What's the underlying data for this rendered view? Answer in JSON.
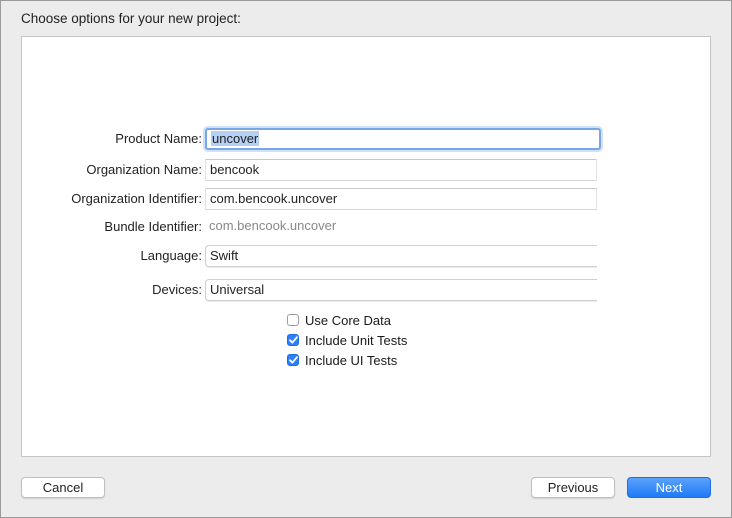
{
  "dialog": {
    "title": "Choose options for your new project:"
  },
  "form": {
    "product_name": {
      "label": "Product Name:",
      "value": "uncover"
    },
    "team": {
      "label": "Organization Name:",
      "value": "bencook"
    },
    "organization_identifier": {
      "label": "Organization Identifier:",
      "value": "com.bencook.uncover"
    },
    "bundle_identifier": {
      "label": "Bundle Identifier:",
      "value": "com.bencook.uncover"
    },
    "language": {
      "label": "Language:",
      "value": "Swift"
    },
    "devices": {
      "label": "Devices:",
      "value": "Universal"
    }
  },
  "options": [
    {
      "label": "Use Core Data",
      "checked": false
    },
    {
      "label": "Include Unit Tests",
      "checked": true
    },
    {
      "label": "Include UI Tests",
      "checked": true
    }
  ],
  "buttons": {
    "cancel": "Cancel",
    "previous": "Previous",
    "next": "Next"
  },
  "colors": {
    "accent": "#2f7ff6",
    "focus_ring": "#79a7e6"
  }
}
